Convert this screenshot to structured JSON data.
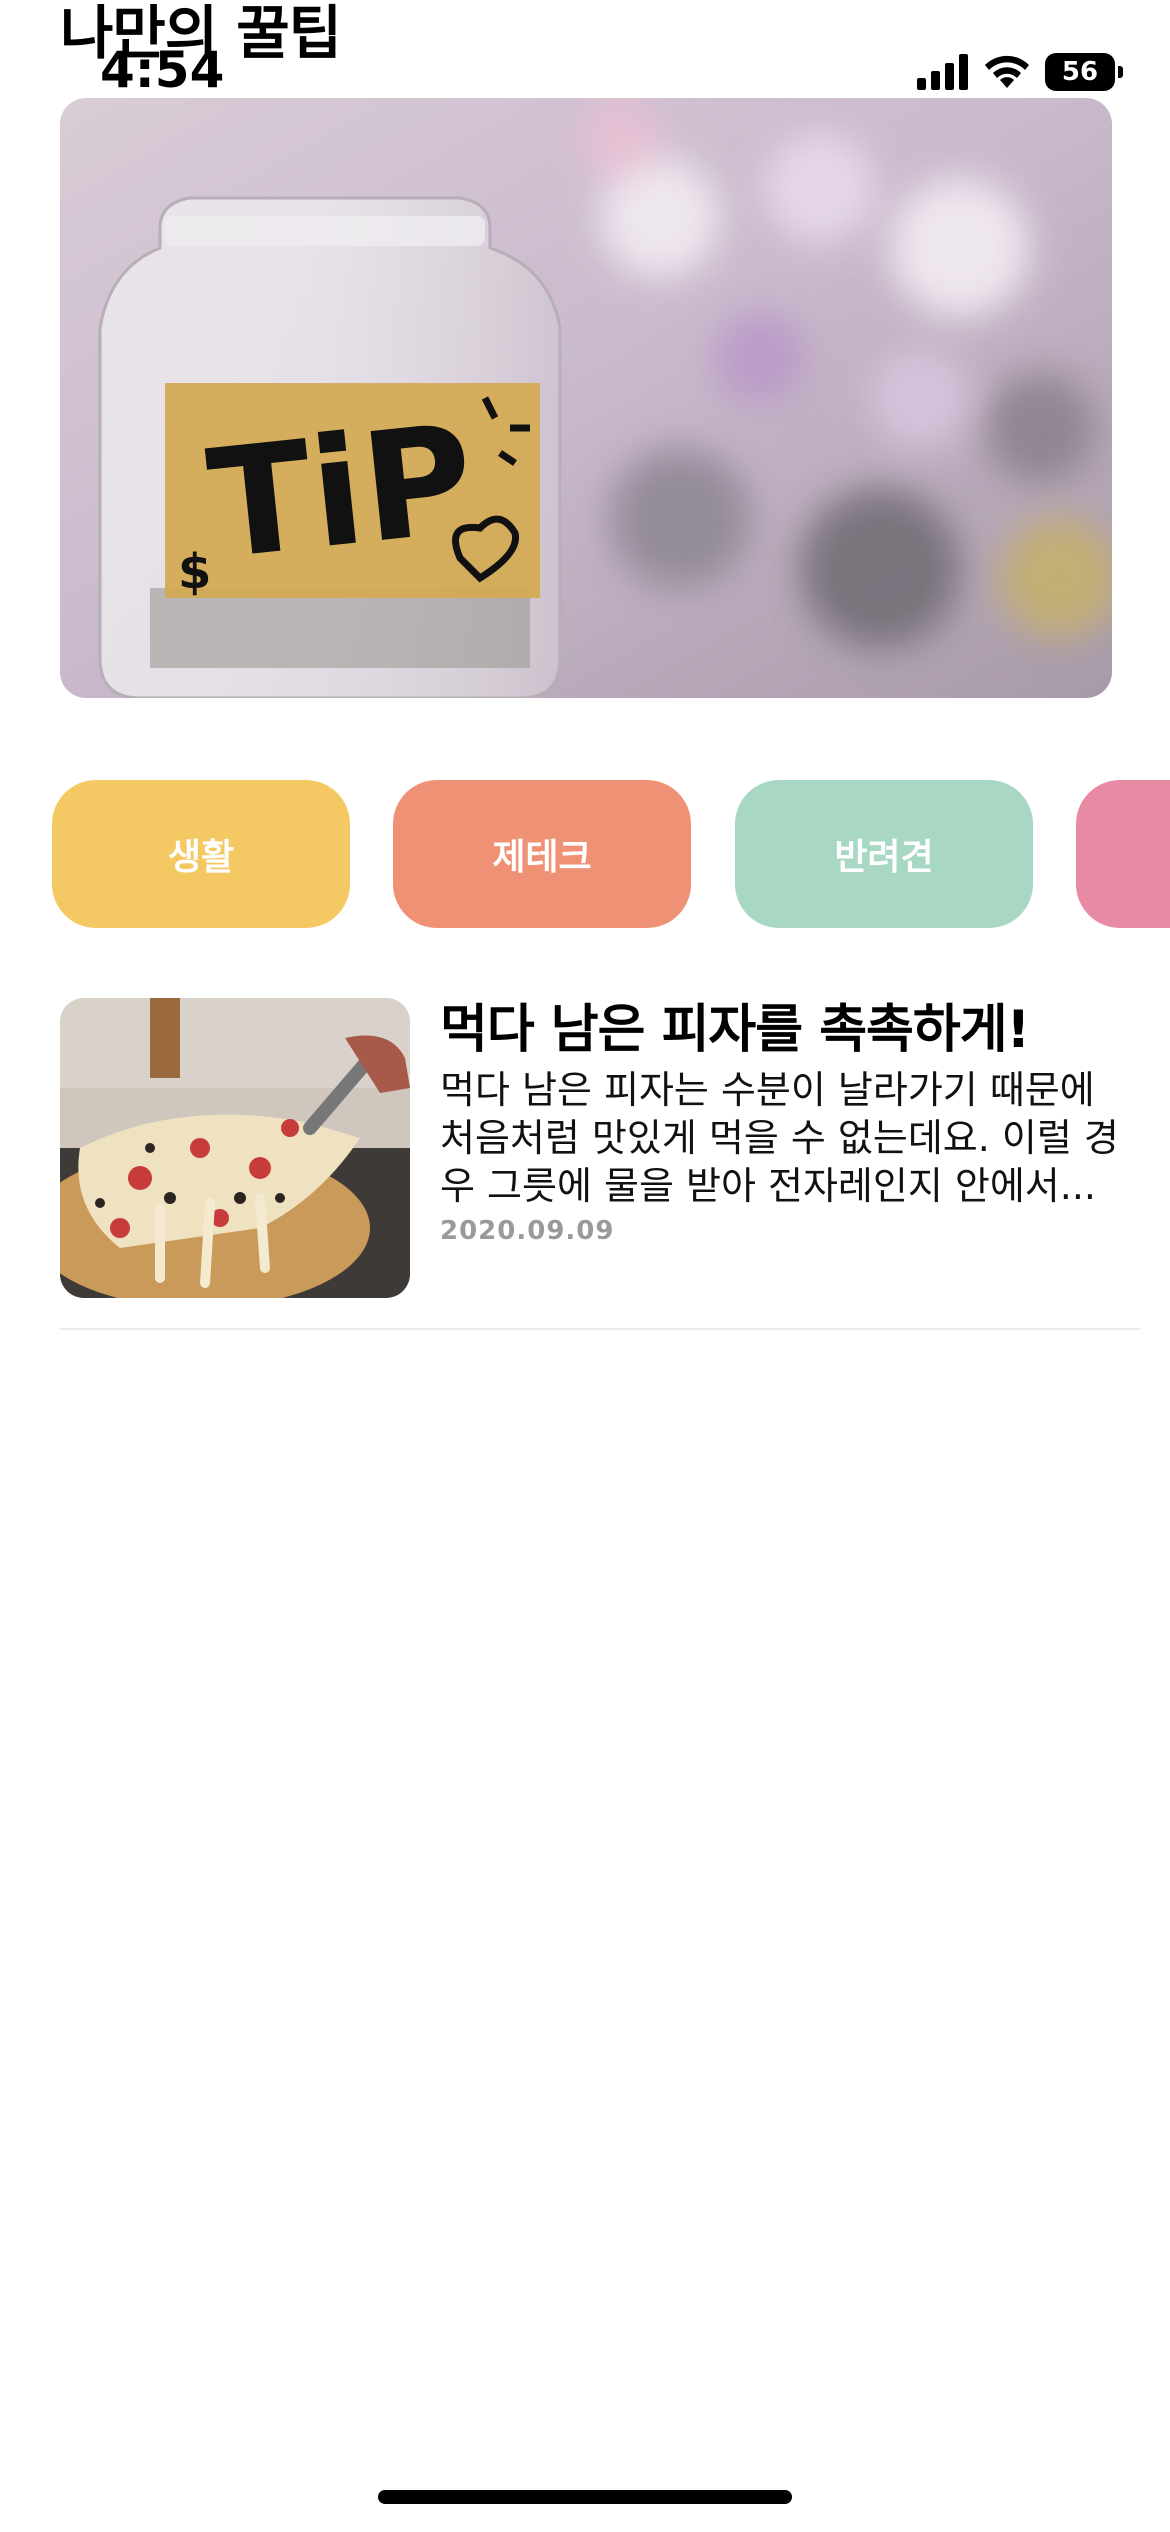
{
  "header": {
    "title": "나만의 꿀팁"
  },
  "status_bar": {
    "time": "4:54",
    "battery": "56",
    "icons": [
      "signal-icon",
      "wifi-icon",
      "battery-icon"
    ]
  },
  "banner": {
    "image": "tip-jar-photo",
    "label_text": "TiP"
  },
  "categories": [
    {
      "label": "생활",
      "color": "#F4C963"
    },
    {
      "label": "제테크",
      "color": "#EF9174"
    },
    {
      "label": "반려견",
      "color": "#A8D8C4"
    },
    {
      "label": "",
      "color": "#E88AA4"
    }
  ],
  "articles": [
    {
      "title": "먹다 남은 피자를 촉촉하게!",
      "excerpt": "먹다 남은 피자는 수분이 날라가기 때문에 처음처럼 맛있게 먹을 수 없는데요. 이럴 경우 그릇에 물을 받아 전자레인지 안에서...",
      "date": "2020.09.09",
      "thumbnail": "pizza-slice-photo"
    }
  ]
}
